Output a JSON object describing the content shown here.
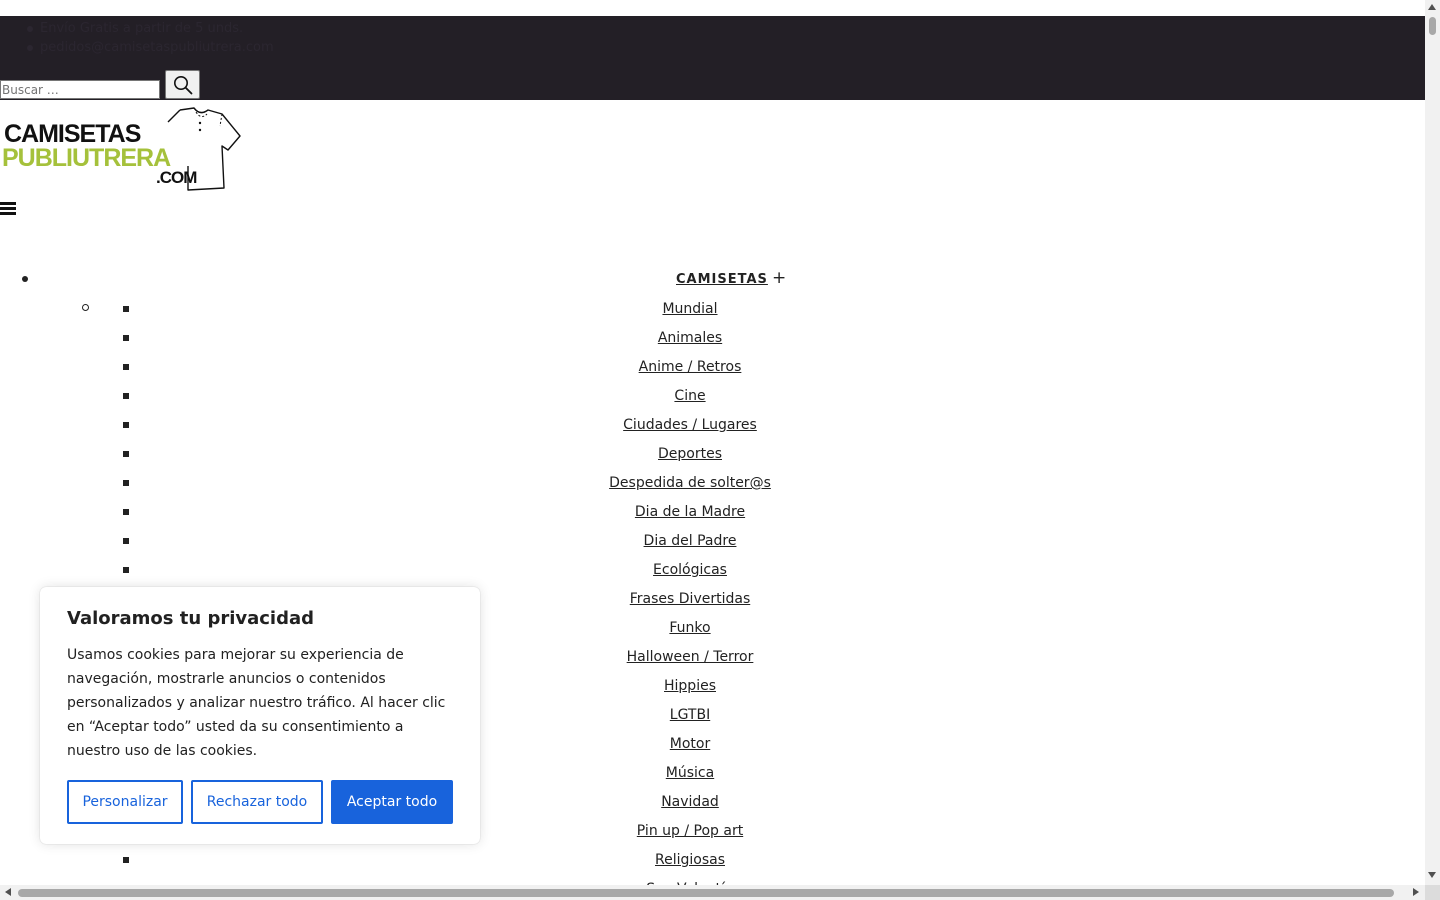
{
  "topbar": {
    "items": [
      {
        "text": "Envío Gratis a partir de 5 unds."
      },
      {
        "text": "pedidos@camisetaspubliutrera.com"
      }
    ]
  },
  "search": {
    "placeholder": "Buscar …",
    "button_icon": "search-icon"
  },
  "logo": {
    "line1": "CAMISETAS",
    "line2": "PUBLIUTRERA",
    "line3": ".COM",
    "colors": {
      "dark": "#111111",
      "green": "#a5c13b"
    }
  },
  "menu_toggle_icon": "hamburger-icon",
  "nav": {
    "main_label": "CAMISETAS",
    "expand_icon": "+",
    "categories": [
      "Mundial",
      "Animales",
      "Anime / Retros",
      "Cine",
      "Ciudades / Lugares",
      "Deportes",
      "Despedida de solter@s",
      "Dia de la Madre",
      "Dia del Padre",
      "Ecológicas",
      "Frases Divertidas",
      "Funko",
      "Halloween / Terror",
      "Hippies",
      "LGTBI",
      "Motor",
      "Música",
      "Navidad",
      "Pin up / Pop art",
      "Religiosas",
      "San Valentín"
    ]
  },
  "cookie": {
    "title": "Valoramos tu privacidad",
    "text": "Usamos cookies para mejorar su experiencia de navegación, mostrarle anuncios o contenidos personalizados y analizar nuestro tráfico. Al hacer clic en “Aceptar todo” usted da su consentimiento a nuestro uso de las cookies.",
    "customize": "Personalizar",
    "reject": "Rechazar todo",
    "accept": "Aceptar todo",
    "accent_color": "#1863dc"
  },
  "colors": {
    "topbar_bg": "#231f26"
  }
}
